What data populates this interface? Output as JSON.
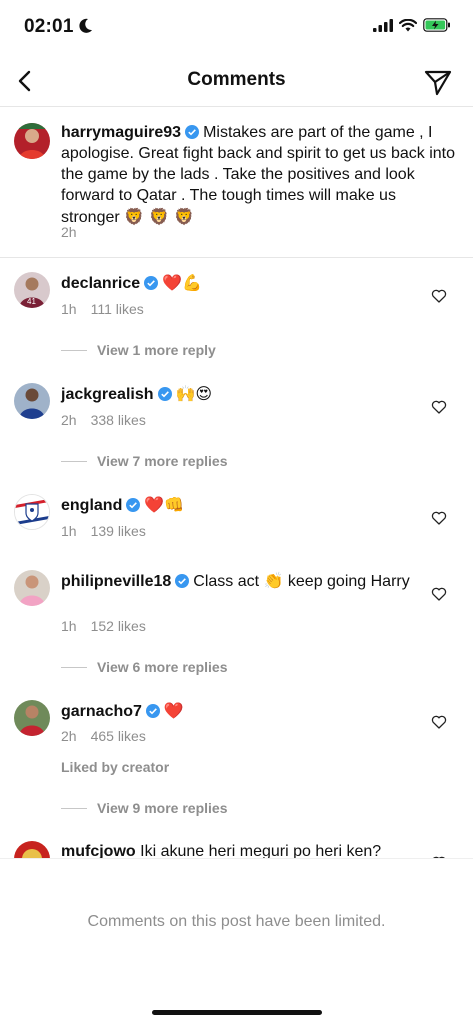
{
  "status": {
    "time": "02:01"
  },
  "header": {
    "title": "Comments"
  },
  "caption": {
    "username": "harrymaguire93",
    "text": "Mistakes are part of the game , I apologise. Great fight back and spirit to get us back into the game by the lads . Take the positives and look forward to Qatar . The tough times will make us stronger",
    "emojis": "🦁 🦁 🦁",
    "time": "2h"
  },
  "comments": [
    {
      "username": "declanrice",
      "text": "",
      "emojis": "❤️💪",
      "time": "1h",
      "likes": "111 likes",
      "replies": "View 1 more reply"
    },
    {
      "username": "jackgrealish",
      "text": "",
      "emojis": "🙌😍",
      "time": "2h",
      "likes": "338 likes",
      "replies": "View 7 more replies"
    },
    {
      "username": "england",
      "text": "",
      "emojis": "❤️👊",
      "time": "1h",
      "likes": "139 likes",
      "replies": ""
    },
    {
      "username": "philipneville18",
      "text": "Class act",
      "text2": "keep going Harry",
      "emojis": "👏",
      "time": "1h",
      "likes": "152 likes",
      "replies": "View 6 more replies"
    },
    {
      "username": "garnacho7",
      "text": "",
      "emojis": "❤️",
      "time": "2h",
      "likes": "465 likes",
      "liked_by": "Liked by creator",
      "replies": "View 9 more replies"
    },
    {
      "username": "mufcjowo",
      "text": "Iki akune heri meguri po heri ken?"
    }
  ],
  "footer": {
    "limited": "Comments on this post have been limited."
  },
  "colors": {
    "verified": "#3897f0",
    "muted": "#8e8e8e",
    "heart": "#ed4956"
  }
}
